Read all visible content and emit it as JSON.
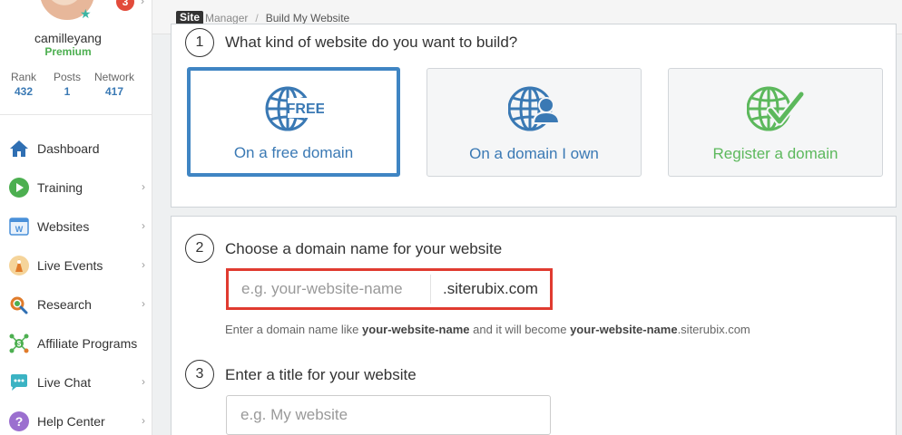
{
  "sidebar": {
    "profile": {
      "username": "camilleyang",
      "membership": "Premium",
      "notification_count": "3",
      "stats": [
        {
          "label": "Rank",
          "value": "432"
        },
        {
          "label": "Posts",
          "value": "1"
        },
        {
          "label": "Network",
          "value": "417"
        }
      ]
    },
    "nav": [
      {
        "label": "Dashboard",
        "icon": "home-icon"
      },
      {
        "label": "Training",
        "icon": "play-icon"
      },
      {
        "label": "Websites",
        "icon": "website-icon"
      },
      {
        "label": "Live Events",
        "icon": "live-events-icon"
      },
      {
        "label": "Research",
        "icon": "research-icon"
      },
      {
        "label": "Affiliate Programs",
        "icon": "affiliate-icon"
      },
      {
        "label": "Live Chat",
        "icon": "chat-icon"
      },
      {
        "label": "Help Center",
        "icon": "help-icon"
      }
    ]
  },
  "breadcrumb": {
    "logo": "Site",
    "manager": "Manager",
    "separator": "/",
    "current": "Build My Website"
  },
  "step1": {
    "number": "1",
    "title": "What kind of website do you want to build?",
    "options": [
      {
        "label": "On a free domain",
        "icon": "globe-free-icon",
        "badge": "FREE",
        "selected": true,
        "color": "#3a79b4"
      },
      {
        "label": "On a domain I own",
        "icon": "globe-person-icon",
        "selected": false,
        "color": "#3a79b4"
      },
      {
        "label": "Register a domain",
        "icon": "globe-check-icon",
        "selected": false,
        "color": "#5cb85c"
      }
    ]
  },
  "step2": {
    "number": "2",
    "title": "Choose a domain name for your website",
    "placeholder": "e.g. your-website-name",
    "suffix": ".siterubix.com",
    "hint_part1": "Enter a domain name like ",
    "hint_bold1": "your-website-name",
    "hint_part2": " and it will become ",
    "hint_bold2": "your-website-name",
    "hint_part3": ".siterubix.com"
  },
  "step3": {
    "number": "3",
    "title": "Enter a title for your website",
    "placeholder": "e.g. My website"
  },
  "colors": {
    "accent_blue": "#3f85c3",
    "green": "#5cb85c",
    "error_red": "#e03b30"
  }
}
